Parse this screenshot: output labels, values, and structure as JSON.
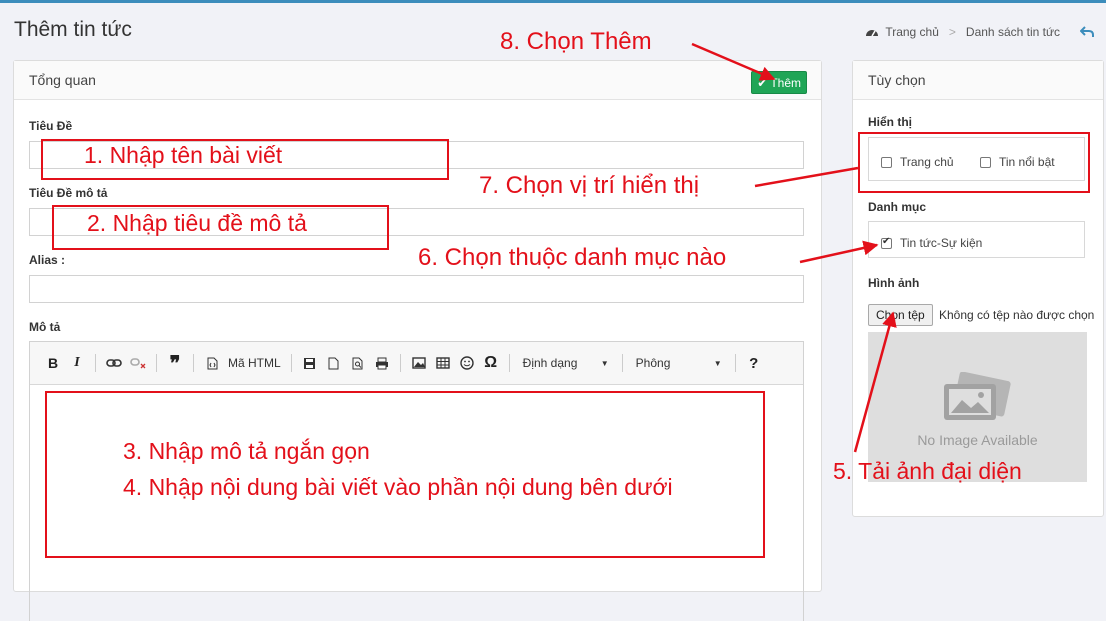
{
  "page": {
    "title": "Thêm tin tức"
  },
  "breadcrumb": {
    "home": "Trang chủ",
    "current": "Danh sách tin tức"
  },
  "main_panel": {
    "title": "Tổng quan",
    "add_button": "Thêm",
    "fields": {
      "title_label": "Tiêu Đề",
      "desc_title_label": "Tiêu Đề mô tả",
      "alias_label": "Alias :",
      "desc_label": "Mô tả"
    },
    "editor_toolbar": {
      "bold": "B",
      "italic": "I",
      "quote": "❞",
      "html": "Mã HTML",
      "format": "Định dạng",
      "font": "Phông",
      "help": "?"
    }
  },
  "side_panel": {
    "title": "Tùy chọn",
    "display_label": "Hiển thị",
    "display_options": [
      "Trang chủ",
      "Tin nổi bật"
    ],
    "category_label": "Danh mục",
    "category_option": "Tin tức-Sự kiện",
    "image_label": "Hình ảnh",
    "file_button": "Chọn tệp",
    "file_status": "Không có tệp nào được chọn",
    "no_image": "No Image Available"
  },
  "annotations": {
    "a1": "1. Nhập tên bài viết",
    "a2": "2. Nhập tiêu đề mô tả",
    "a3": "3. Nhập mô tả ngắn gọn",
    "a4": "4. Nhập nội dung bài viết vào phần nội dung bên dưới",
    "a5": "5. Tải ảnh đại diện",
    "a6": "6. Chọn thuộc danh mục nào",
    "a7": "7. Chọn vị trí hiển thị",
    "a8": "8. Chọn Thêm"
  },
  "colors": {
    "annotation": "#e3101a",
    "add_button": "#1fa556",
    "topbar": "#3c8dbc"
  }
}
